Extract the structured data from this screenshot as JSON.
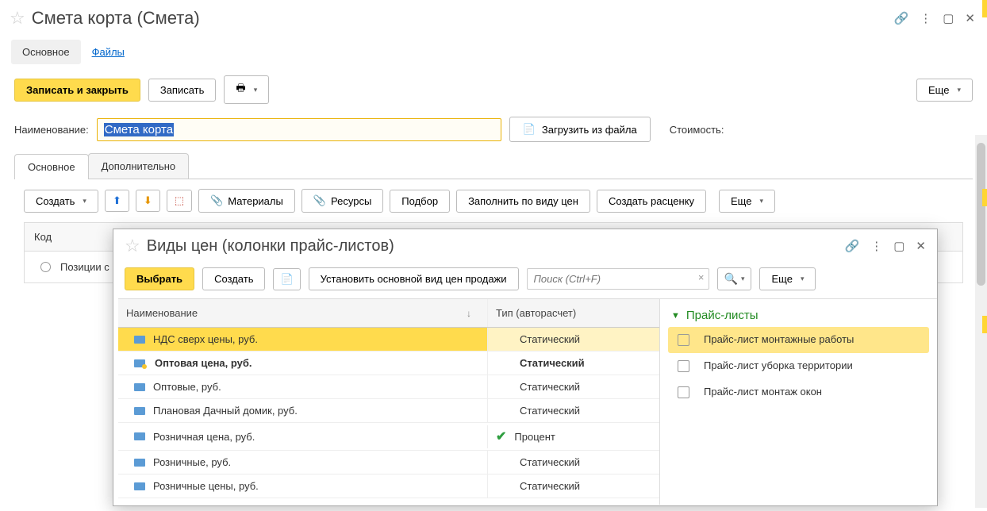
{
  "window": {
    "title": "Смета корта (Смета)"
  },
  "nav": {
    "main": "Основное",
    "files": "Файлы"
  },
  "toolbar": {
    "save_close": "Записать и закрыть",
    "save": "Записать",
    "more": "Еще"
  },
  "form": {
    "name_label": "Наименование:",
    "name_value": "Смета корта",
    "load_file": "Загрузить из файла",
    "cost_label": "Стоимость:"
  },
  "subtabs": {
    "main": "Основное",
    "extra": "Дополнительно"
  },
  "subtoolbar": {
    "create": "Создать",
    "materials": "Материалы",
    "resources": "Ресурсы",
    "pick": "Подбор",
    "fill_by_price": "Заполнить по виду цен",
    "create_rate": "Создать расценку",
    "more": "Еще"
  },
  "table": {
    "col_code": "Код",
    "row0": "Позиции с"
  },
  "dialog": {
    "title": "Виды цен (колонки прайс-листов)",
    "select": "Выбрать",
    "create": "Создать",
    "set_main": "Установить основной вид цен продажи",
    "search_ph": "Поиск (Ctrl+F)",
    "more": "Еще",
    "col_name": "Наименование",
    "col_type": "Тип (авторасчет)",
    "rows": [
      {
        "name": "НДС сверх цены, руб.",
        "type": "Статический",
        "selected": true,
        "bold": false,
        "check": false
      },
      {
        "name": "Оптовая цена, руб.",
        "type": "Статический",
        "selected": false,
        "bold": true,
        "check": false,
        "ydot": true
      },
      {
        "name": "Оптовые, руб.",
        "type": "Статический",
        "selected": false,
        "bold": false,
        "check": false
      },
      {
        "name": "Плановая  Дачный домик, руб.",
        "type": "Статический",
        "selected": false,
        "bold": false,
        "check": false
      },
      {
        "name": "Розничная цена, руб.",
        "type": "Процент",
        "selected": false,
        "bold": false,
        "check": true
      },
      {
        "name": "Розничные, руб.",
        "type": "Статический",
        "selected": false,
        "bold": false,
        "check": false
      },
      {
        "name": "Розничные цены, руб.",
        "type": "Статический",
        "selected": false,
        "bold": false,
        "check": false
      }
    ],
    "side": {
      "header": "Прайс-листы",
      "items": [
        {
          "label": "Прайс-лист монтажные работы",
          "sel": true
        },
        {
          "label": "Прайс-лист уборка территории",
          "sel": false
        },
        {
          "label": "Прайс-лист монтаж окон",
          "sel": false
        }
      ]
    }
  }
}
